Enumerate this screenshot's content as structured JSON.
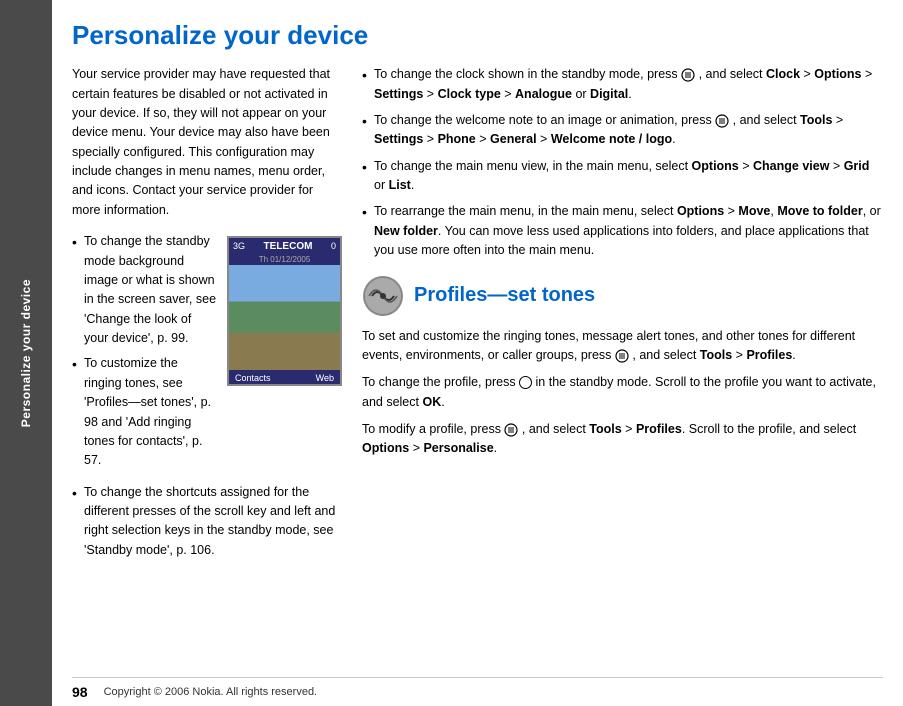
{
  "sidebar": {
    "label": "Personalize your device"
  },
  "page": {
    "title": "Personalize your device",
    "intro": "Your service provider may have requested that certain features be disabled or not activated in your device. If so, they will not appear on your device menu. Your device may also have been specially configured. This configuration may include changes in menu names, menu order, and icons. Contact your service provider for more information.",
    "left_bullets": [
      "To change the standby mode background image or what is shown in the screen saver, see 'Change the look of your device', p. 99.",
      "To customize the ringing tones, see 'Profiles—set tones', p. 98 and 'Add ringing tones for contacts', p. 57.",
      "To change the shortcuts assigned for the different presses of the scroll key and left and right selection keys in the standby mode, see 'Standby mode', p. 106."
    ],
    "right_bullets": [
      {
        "text_parts": [
          "To change the clock shown in the standby mode, press ",
          " , and select ",
          "Clock",
          " > ",
          "Options",
          " > ",
          "Settings",
          " > ",
          "Clock type",
          " > ",
          "Analogue",
          " or ",
          "Digital",
          "."
        ],
        "bold_indices": [
          2,
          4,
          6,
          8,
          10,
          12
        ]
      },
      {
        "text_parts": [
          "To change the welcome note to an image or animation, press ",
          " , and select ",
          "Tools",
          " > ",
          "Settings",
          " > ",
          "Phone",
          " > ",
          "General",
          " > ",
          "Welcome note / logo",
          "."
        ],
        "bold_indices": [
          2,
          4,
          6,
          8,
          10
        ]
      },
      {
        "text_parts": [
          "To change the main menu view, in the main menu, select ",
          "Options",
          " > ",
          "Change view",
          " > ",
          "Grid",
          " or ",
          "List",
          "."
        ],
        "bold_indices": [
          1,
          3,
          5,
          7
        ]
      },
      {
        "text_parts": [
          "To rearrange the main menu, in the main menu, select ",
          "Options",
          " > ",
          "Move",
          ", ",
          "Move to folder",
          ", or ",
          "New folder",
          ". You can move less used applications into folders, and place applications that you use more often into the main menu."
        ],
        "bold_indices": [
          1,
          3,
          5,
          7
        ]
      }
    ],
    "profiles_section": {
      "title": "Profiles—set tones",
      "para1_parts": [
        "To set and customize the ringing tones, message alert tones, and other tones for different events, environments, or caller groups, press ",
        " , and select ",
        "Tools",
        " > ",
        "Profiles",
        "."
      ],
      "para1_bold": [
        2,
        4
      ],
      "para2_parts": [
        "To change the profile, press ",
        " in the standby mode. Scroll to the profile you want to activate, and select ",
        "OK",
        "."
      ],
      "para2_bold": [
        2
      ],
      "para3_parts": [
        "To modify a profile, press ",
        " , and select ",
        "Tools",
        " > ",
        "Profiles",
        ". Scroll to the profile, and select ",
        "Options",
        " > ",
        "Personalise",
        "."
      ],
      "para3_bold": [
        2,
        4,
        6,
        8
      ]
    },
    "phone_screen": {
      "telecom": "TELECOM",
      "signal": "3G",
      "date": "Th 01/12/2005",
      "zero": "0",
      "contacts": "Contacts",
      "web": "Web"
    },
    "footer": {
      "page_number": "98",
      "copyright": "Copyright © 2006 Nokia. All rights reserved."
    }
  }
}
